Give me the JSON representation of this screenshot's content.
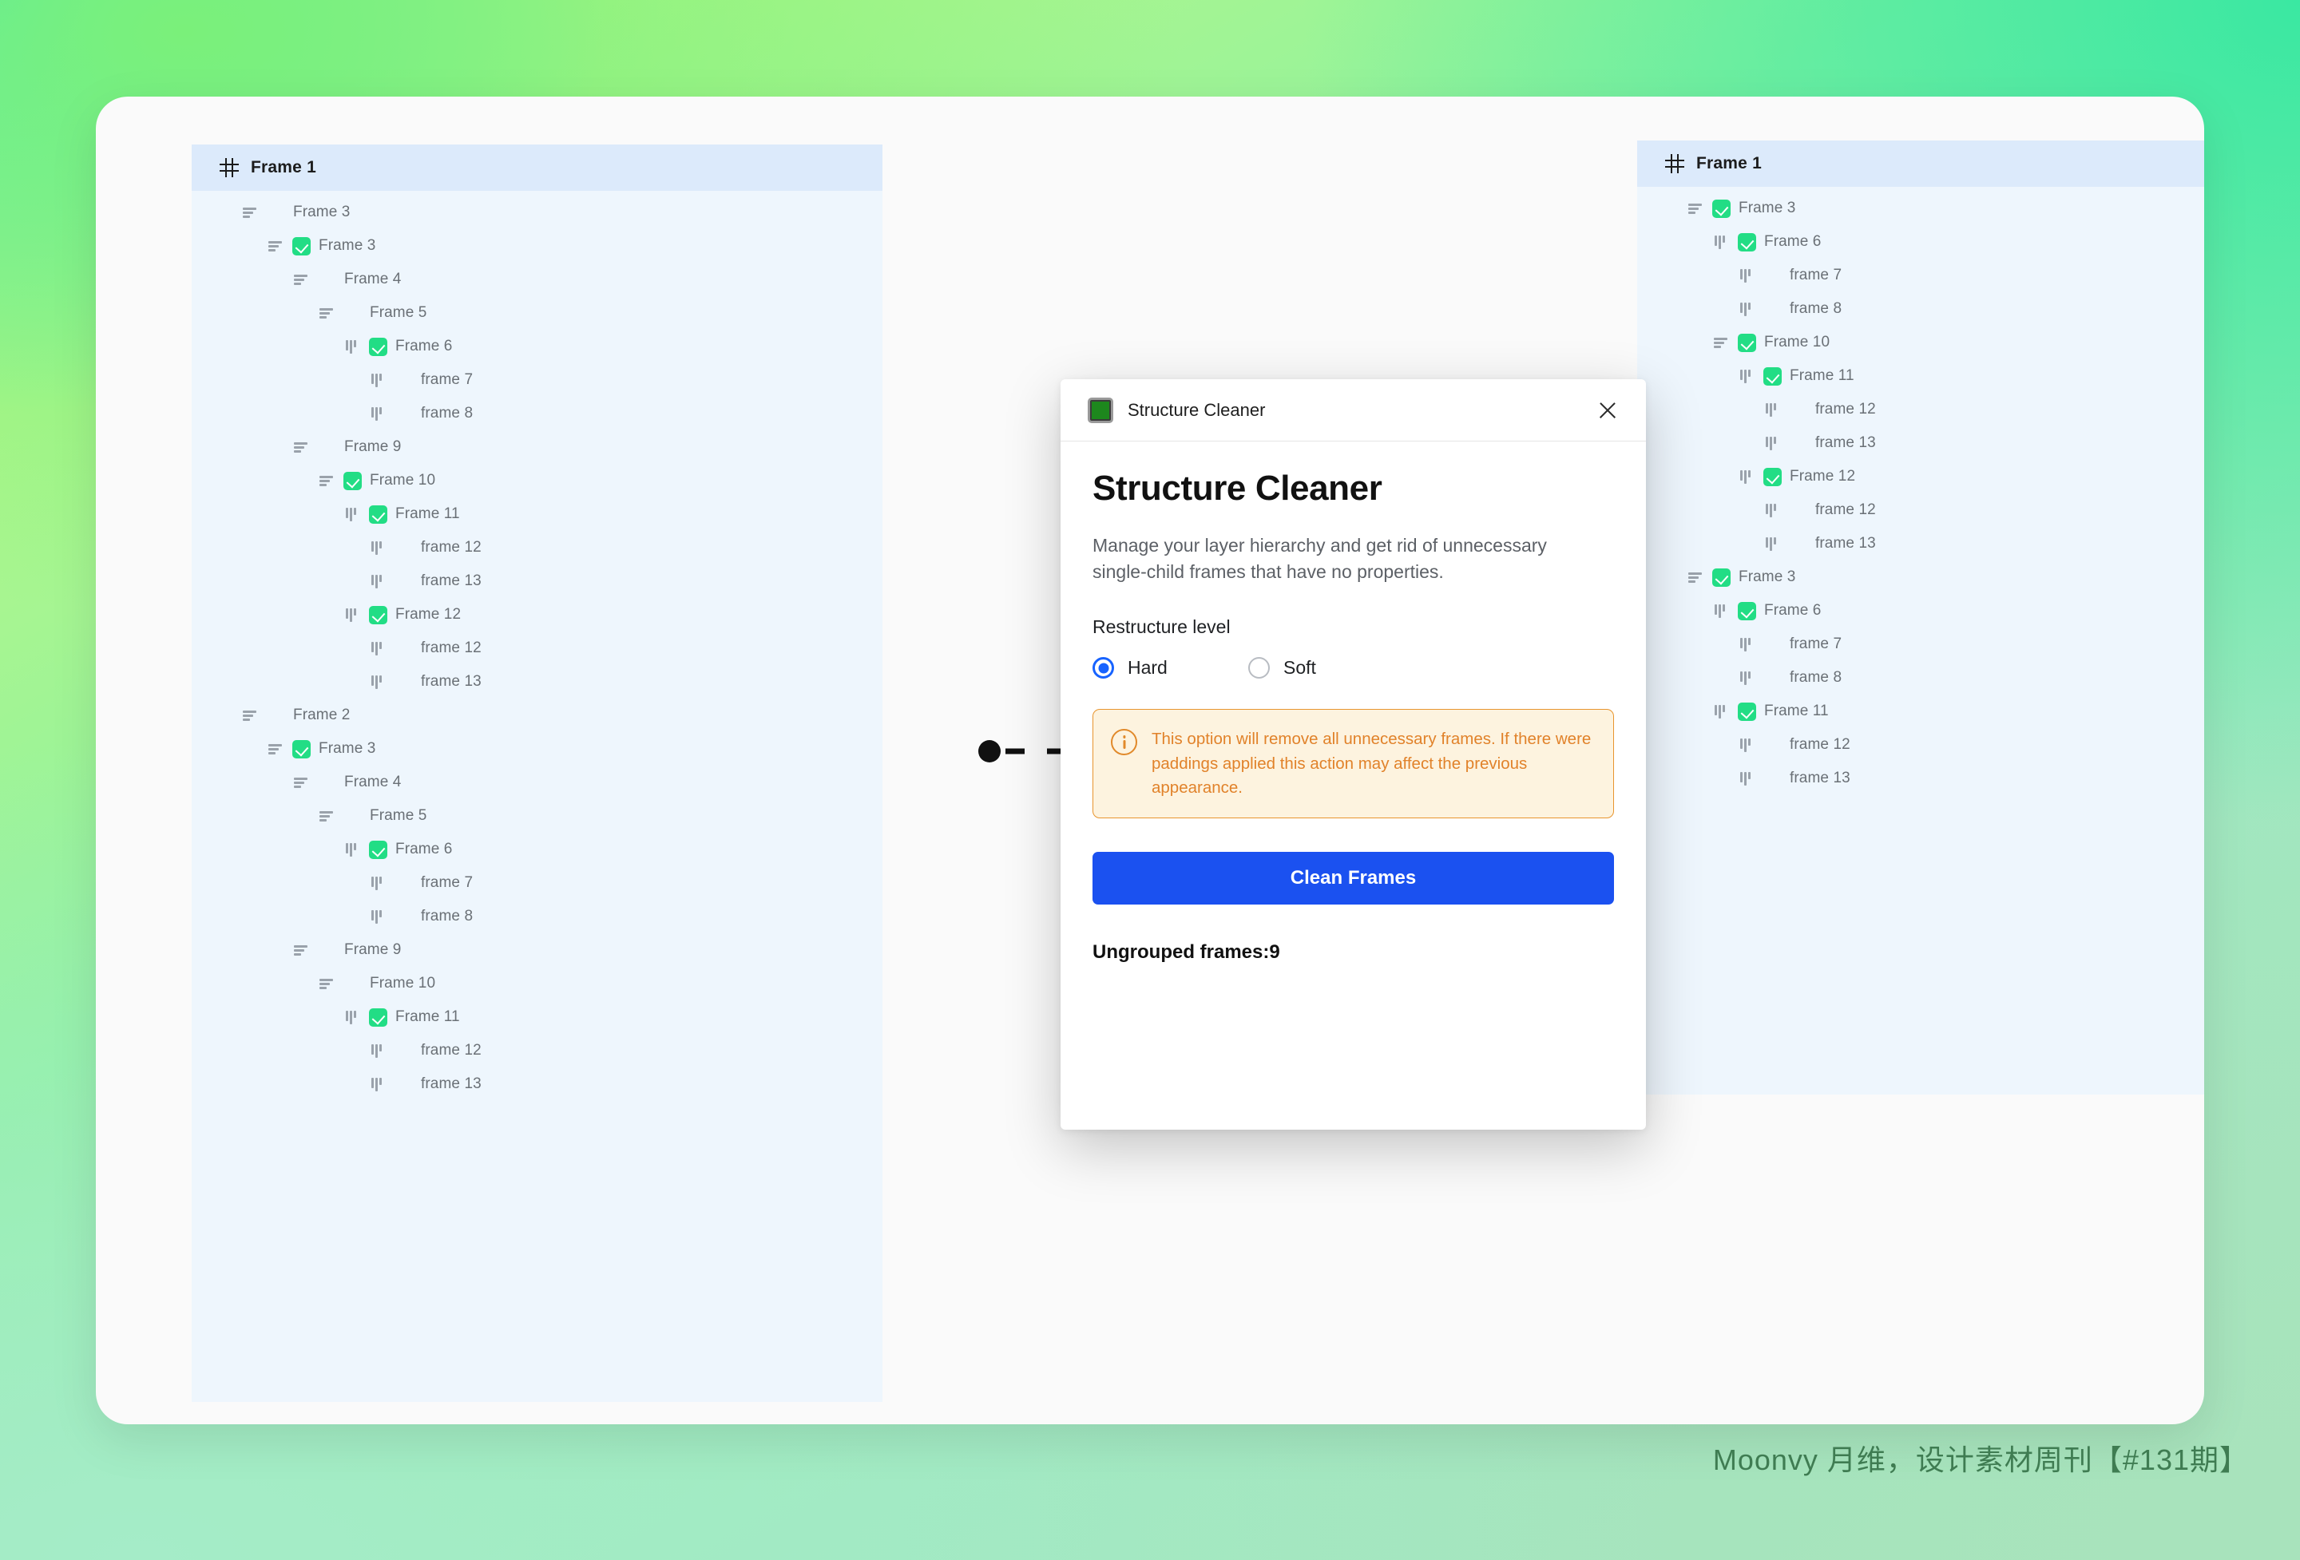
{
  "watermark": "Moonvy 月维，设计素材周刊【#131期】",
  "connector": {
    "start_dot": "filled-circle",
    "line_style": "dashed",
    "arrow_head": "chevron-right",
    "color": "#111111"
  },
  "tree_before": {
    "header": {
      "label": "Frame 1",
      "icon": "hash-icon"
    },
    "rows": [
      {
        "label": "Frame 3",
        "depth": 1,
        "icon": "vstack-icon",
        "checked": false
      },
      {
        "label": "Frame 3",
        "depth": 2,
        "icon": "vstack-icon",
        "checked": true
      },
      {
        "label": "Frame 4",
        "depth": 3,
        "icon": "vstack-icon",
        "checked": false
      },
      {
        "label": "Frame 5",
        "depth": 4,
        "icon": "vstack-icon",
        "checked": false
      },
      {
        "label": "Frame 6",
        "depth": 5,
        "icon": "hstack-icon",
        "checked": true
      },
      {
        "label": "frame 7",
        "depth": 6,
        "icon": "hstack-icon",
        "checked": false
      },
      {
        "label": "frame 8",
        "depth": 6,
        "icon": "hstack-icon",
        "checked": false
      },
      {
        "label": "Frame 9",
        "depth": 3,
        "icon": "vstack-icon",
        "checked": false
      },
      {
        "label": "Frame 10",
        "depth": 4,
        "icon": "vstack-icon",
        "checked": true
      },
      {
        "label": "Frame 11",
        "depth": 5,
        "icon": "hstack-icon",
        "checked": true
      },
      {
        "label": "frame 12",
        "depth": 6,
        "icon": "hstack-icon",
        "checked": false
      },
      {
        "label": "frame 13",
        "depth": 6,
        "icon": "hstack-icon",
        "checked": false
      },
      {
        "label": "Frame 12",
        "depth": 5,
        "icon": "hstack-icon",
        "checked": true
      },
      {
        "label": "frame 12",
        "depth": 6,
        "icon": "hstack-icon",
        "checked": false
      },
      {
        "label": "frame 13",
        "depth": 6,
        "icon": "hstack-icon",
        "checked": false
      },
      {
        "label": "Frame 2",
        "depth": 1,
        "icon": "vstack-icon",
        "checked": false
      },
      {
        "label": "Frame 3",
        "depth": 2,
        "icon": "vstack-icon",
        "checked": true
      },
      {
        "label": "Frame 4",
        "depth": 3,
        "icon": "vstack-icon",
        "checked": false
      },
      {
        "label": "Frame 5",
        "depth": 4,
        "icon": "vstack-icon",
        "checked": false
      },
      {
        "label": "Frame 6",
        "depth": 5,
        "icon": "hstack-icon",
        "checked": true
      },
      {
        "label": "frame 7",
        "depth": 6,
        "icon": "hstack-icon",
        "checked": false
      },
      {
        "label": "frame 8",
        "depth": 6,
        "icon": "hstack-icon",
        "checked": false
      },
      {
        "label": "Frame 9",
        "depth": 3,
        "icon": "vstack-icon",
        "checked": false
      },
      {
        "label": "Frame 10",
        "depth": 4,
        "icon": "vstack-icon",
        "checked": false
      },
      {
        "label": "Frame 11",
        "depth": 5,
        "icon": "hstack-icon",
        "checked": true
      },
      {
        "label": "frame 12",
        "depth": 6,
        "icon": "hstack-icon",
        "checked": false
      },
      {
        "label": "frame 13",
        "depth": 6,
        "icon": "hstack-icon",
        "checked": false
      }
    ]
  },
  "tree_after": {
    "header": {
      "label": "Frame 1",
      "icon": "hash-icon"
    },
    "rows": [
      {
        "label": "Frame 3",
        "depth": 1,
        "icon": "vstack-icon",
        "checked": true
      },
      {
        "label": "Frame 6",
        "depth": 2,
        "icon": "hstack-icon",
        "checked": true
      },
      {
        "label": "frame 7",
        "depth": 3,
        "icon": "hstack-icon",
        "checked": false
      },
      {
        "label": "frame 8",
        "depth": 3,
        "icon": "hstack-icon",
        "checked": false
      },
      {
        "label": "Frame 10",
        "depth": 2,
        "icon": "vstack-icon",
        "checked": true
      },
      {
        "label": "Frame 11",
        "depth": 3,
        "icon": "hstack-icon",
        "checked": true
      },
      {
        "label": "frame 12",
        "depth": 4,
        "icon": "hstack-icon",
        "checked": false
      },
      {
        "label": "frame 13",
        "depth": 4,
        "icon": "hstack-icon",
        "checked": false
      },
      {
        "label": "Frame 12",
        "depth": 3,
        "icon": "hstack-icon",
        "checked": true
      },
      {
        "label": "frame 12",
        "depth": 4,
        "icon": "hstack-icon",
        "checked": false
      },
      {
        "label": "frame 13",
        "depth": 4,
        "icon": "hstack-icon",
        "checked": false
      },
      {
        "label": "Frame 3",
        "depth": 1,
        "icon": "vstack-icon",
        "checked": true
      },
      {
        "label": "Frame 6",
        "depth": 2,
        "icon": "hstack-icon",
        "checked": true
      },
      {
        "label": "frame 7",
        "depth": 3,
        "icon": "hstack-icon",
        "checked": false
      },
      {
        "label": "frame 8",
        "depth": 3,
        "icon": "hstack-icon",
        "checked": false
      },
      {
        "label": "Frame 11",
        "depth": 2,
        "icon": "hstack-icon",
        "checked": true
      },
      {
        "label": "frame 12",
        "depth": 3,
        "icon": "hstack-icon",
        "checked": false
      },
      {
        "label": "frame 13",
        "depth": 3,
        "icon": "hstack-icon",
        "checked": false
      }
    ]
  },
  "dialog": {
    "titlebar": {
      "title": "Structure Cleaner",
      "app_icon": "green-square-icon",
      "close_icon": "close-icon"
    },
    "heading": "Structure Cleaner",
    "description": "Manage your layer hierarchy and get rid of unnecessary single-child frames that have no properties.",
    "restructure_label": "Restructure level",
    "options": [
      {
        "label": "Hard",
        "selected": true
      },
      {
        "label": "Soft",
        "selected": false
      }
    ],
    "warning": {
      "icon": "info-icon",
      "text": "This option will remove all unnecessary frames. If there were paddings applied this action may affect the previous appearance.",
      "color": "#e1822a",
      "background": "#fdf3df"
    },
    "primary_button": {
      "label": "Clean Frames",
      "color": "#1b51f0"
    },
    "footer": "Ungrouped frames:9"
  }
}
